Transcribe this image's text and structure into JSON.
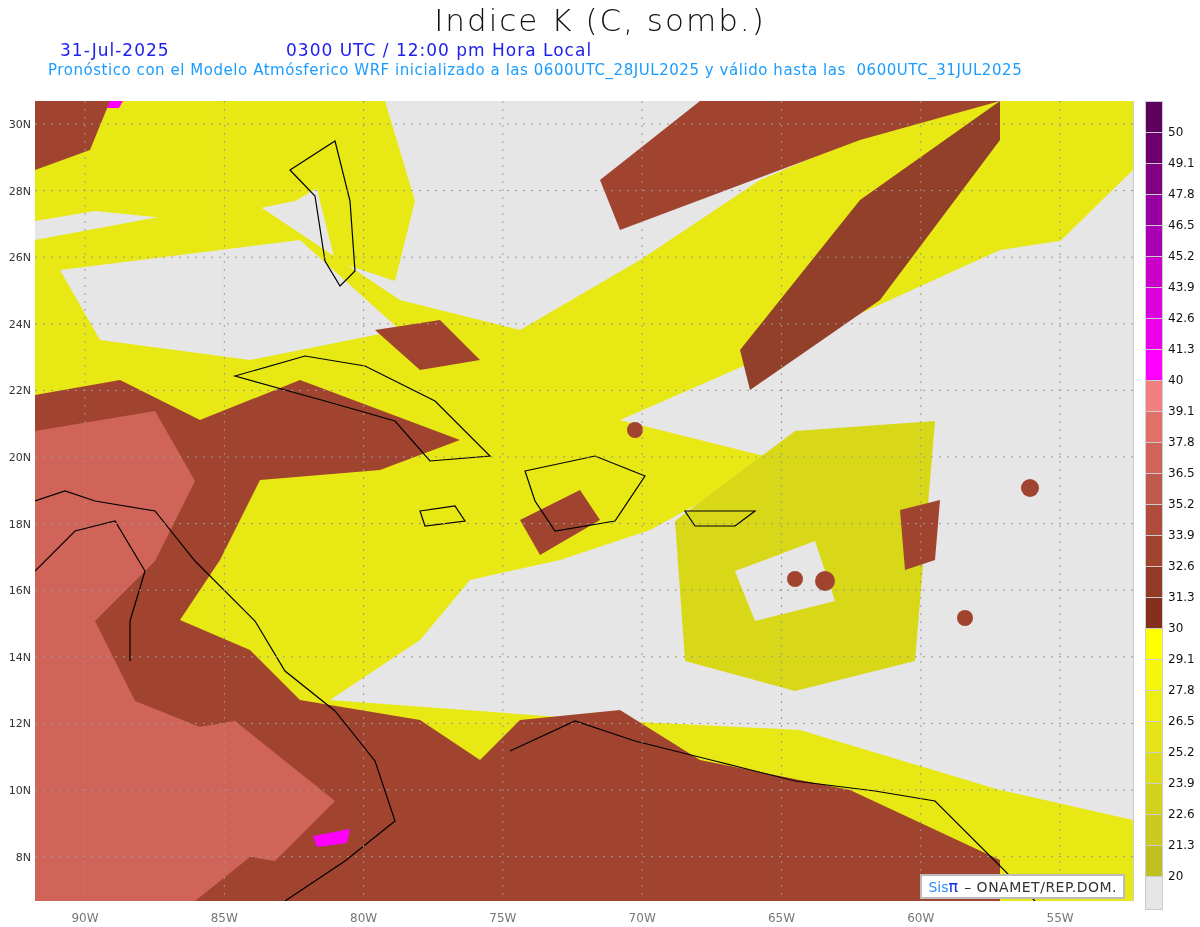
{
  "title": "Indice K (C, somb.)",
  "date": "31-Jul-2025",
  "time": "0300 UTC / 12:00 pm Hora Local",
  "subtitle": "Pronóstico con el Modelo Atmósferico WRF inicializado a las 0600UTC_28JUL2025 y válido hasta las  0600UTC_31JUL2025",
  "lat_labels": [
    "30N",
    "28N",
    "26N",
    "24N",
    "22N",
    "20N",
    "18N",
    "16N",
    "14N",
    "12N",
    "10N",
    "8N"
  ],
  "lon_labels": [
    "90W",
    "85W",
    "80W",
    "75W",
    "70W",
    "65W",
    "60W",
    "55W"
  ],
  "legend": {
    "entries": [
      {
        "label": "50",
        "color": "#5e005e"
      },
      {
        "label": "49.1",
        "color": "#6e006e"
      },
      {
        "label": "47.8",
        "color": "#820082"
      },
      {
        "label": "46.5",
        "color": "#9600a0"
      },
      {
        "label": "45.2",
        "color": "#aa00b4"
      },
      {
        "label": "43.9",
        "color": "#c800c8"
      },
      {
        "label": "42.6",
        "color": "#dc00dc"
      },
      {
        "label": "41.3",
        "color": "#ec00ec"
      },
      {
        "label": "40",
        "color": "#ff00ff"
      },
      {
        "label": "39.1",
        "color": "#f28080"
      },
      {
        "label": "37.8",
        "color": "#e07068"
      },
      {
        "label": "36.5",
        "color": "#d06458"
      },
      {
        "label": "35.2",
        "color": "#c05a4c"
      },
      {
        "label": "33.9",
        "color": "#b04c3c"
      },
      {
        "label": "32.6",
        "color": "#a04430"
      },
      {
        "label": "31.3",
        "color": "#923a26"
      },
      {
        "label": "30",
        "color": "#84301c"
      },
      {
        "label": "29.1",
        "color": "#ffff00"
      },
      {
        "label": "27.8",
        "color": "#f6f60c"
      },
      {
        "label": "26.5",
        "color": "#eeee14"
      },
      {
        "label": "25.2",
        "color": "#e4e418"
      },
      {
        "label": "23.9",
        "color": "#dcdc1c"
      },
      {
        "label": "22.6",
        "color": "#d2d21e"
      },
      {
        "label": "21.3",
        "color": "#caca20"
      },
      {
        "label": "20",
        "color": "#c0c022"
      },
      {
        "color": "#e6e6e6"
      }
    ]
  },
  "credit": {
    "logo_left": "Sis",
    "logo_right": "π",
    "text": "– ONAMET/REP.DOM."
  }
}
